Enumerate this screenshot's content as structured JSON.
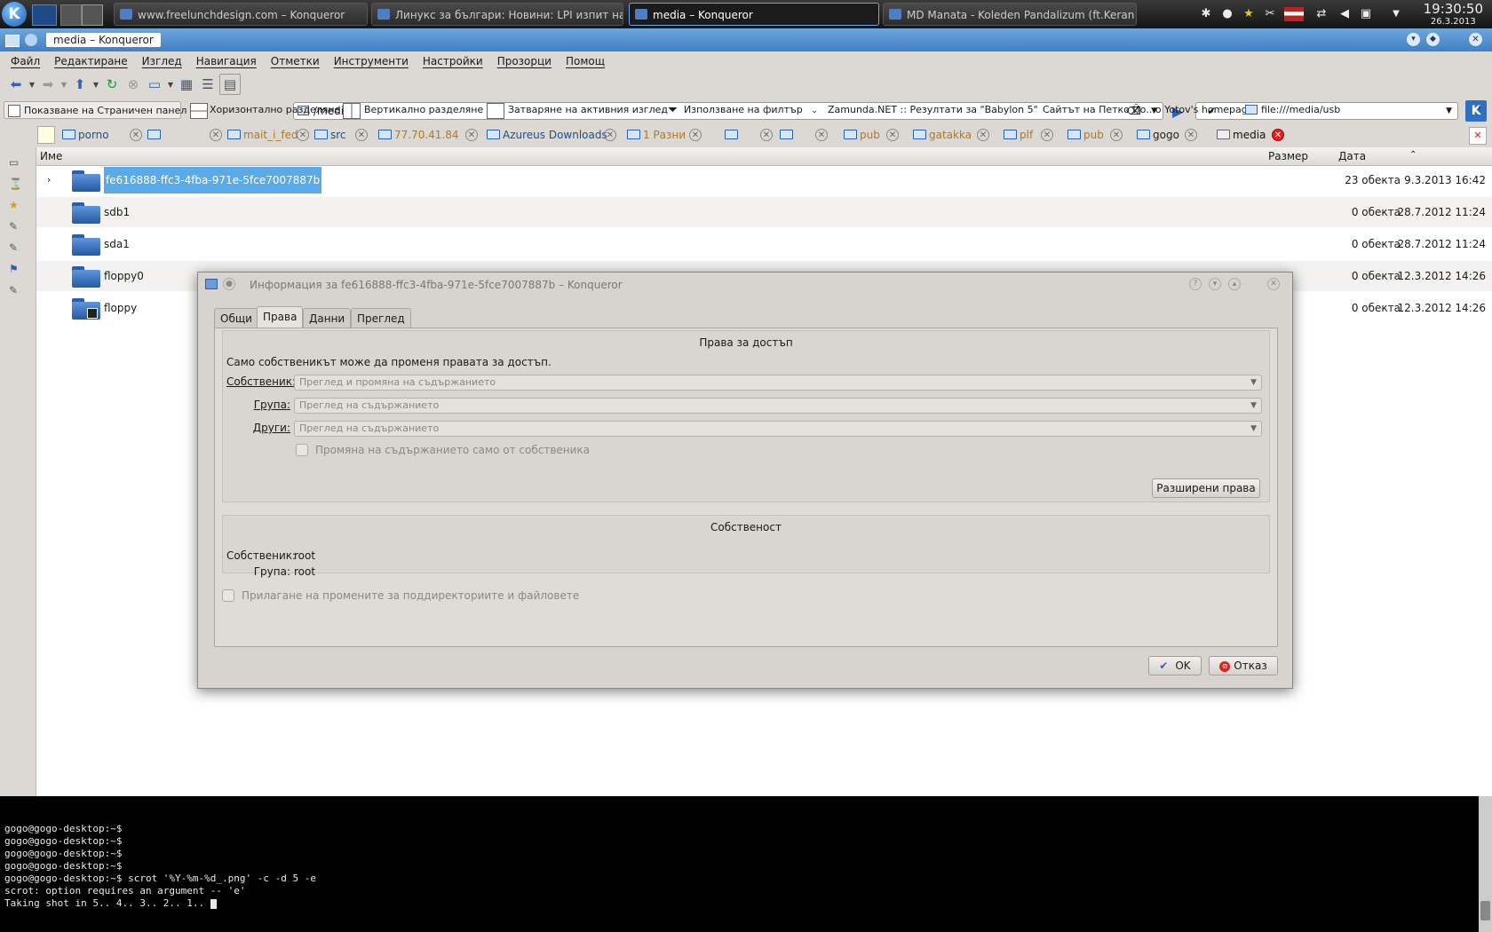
{
  "taskbar": {
    "tasks": [
      {
        "label": "www.freelunchdesign.com – Konqueror"
      },
      {
        "label": "Линукс за българи: Новини: LPI изпит на 27 а"
      },
      {
        "label": "media – Konqueror"
      },
      {
        "label": "MD Manata - Koleden Pandalizum (ft.Keran"
      }
    ],
    "time": "19:30:50",
    "date": "26.3.2013"
  },
  "window": {
    "title": "media – Konqueror",
    "menu": [
      "Файл",
      "Редактиране",
      "Изглед",
      "Навигация",
      "Отметки",
      "Инструменти",
      "Настройки",
      "Прозорци",
      "Помощ"
    ],
    "url": "/media/",
    "search_value": "✔"
  },
  "bookmarks": [
    "Показване на Страничен панел",
    "Хоризонтално разделяне",
    "Вертикално разделяне",
    "Затваряне на активния изглед",
    "Използване на филтър",
    "Zamunda.NET :: Резултати за \"Babylon 5\"",
    "Сайтът на Петко Йо...o Yotov's homepage",
    "file:///media/usb"
  ],
  "tabs": [
    "porno",
    "",
    "mait_i_fed",
    "src",
    "77.70.41.84",
    "Azureus Downloads",
    "1 Разни",
    "",
    "",
    "pub",
    "gatakka",
    "plf",
    "pub",
    "gogo",
    "media"
  ],
  "columns": {
    "name": "Име",
    "size": "Размер",
    "date": "Дата"
  },
  "files": [
    {
      "name": "fe616888-ffc3-4fba-971e-5fce7007887b",
      "size": "23 обекта",
      "date": "9.3.2013 16:42"
    },
    {
      "name": "sdb1",
      "size": "0 обекта",
      "date": "28.7.2012 11:24"
    },
    {
      "name": "sda1",
      "size": "0 обекта",
      "date": "28.7.2012 11:24"
    },
    {
      "name": "floppy0",
      "size": "0 обекта",
      "date": "12.3.2012 14:26"
    },
    {
      "name": "floppy",
      "size": "0 обекта",
      "date": "12.3.2012 14:26"
    }
  ],
  "terminal": [
    "gogo@gogo-desktop:~$",
    "gogo@gogo-desktop:~$",
    "gogo@gogo-desktop:~$",
    "gogo@gogo-desktop:~$",
    "gogo@gogo-desktop:~$ scrot '%Y-%m-%d_.png' -c -d 5 -e",
    "scrot: option requires an argument -- 'e'",
    "Taking shot in 5.. 4.. 3.. 2.. 1.. "
  ],
  "dialog": {
    "title": "Информация за fe616888-ffc3-4fba-971e-5fce7007887b – Konqueror",
    "tabs": [
      "Общи",
      "Права",
      "Данни",
      "Преглед"
    ],
    "access_title": "Права за достъп",
    "note": "Само собственикът може да променя правата за достъп.",
    "owner_label": "Собственик:",
    "owner_value": "Преглед и промяна на съдържанието",
    "group_label": "Група:",
    "group_value": "Преглед на съдържанието",
    "others_label": "Други:",
    "others_value": "Преглед на съдържанието",
    "only_owner": "Промяна на съдържанието само от собственика",
    "advanced": "Разширени права",
    "ownership_title": "Собственост",
    "ownership_owner_label": "Собственик:",
    "ownership_owner": "root",
    "ownership_group_label": "Група:",
    "ownership_group": "root",
    "apply_recursive": "Прилагане на промените за поддиректориите и файловете",
    "ok": "OK",
    "cancel": "Отказ"
  }
}
